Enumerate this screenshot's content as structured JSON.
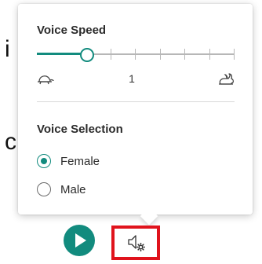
{
  "background_text": {
    "line1": "i",
    "line2": "c"
  },
  "voice_speed": {
    "title": "Voice Speed",
    "value": "1",
    "slider_fraction": 0.25,
    "slow_icon": "turtle-icon",
    "fast_icon": "rabbit-icon"
  },
  "voice_selection": {
    "title": "Voice Selection",
    "options": [
      {
        "label": "Female",
        "selected": true
      },
      {
        "label": "Male",
        "selected": false
      }
    ]
  },
  "toolbar": {
    "play_icon": "play-icon",
    "voice_settings_icon": "speaker-gear-icon"
  },
  "colors": {
    "accent": "#128b7e",
    "highlight_box": "#e0131c",
    "track": "#b7b7b7"
  }
}
